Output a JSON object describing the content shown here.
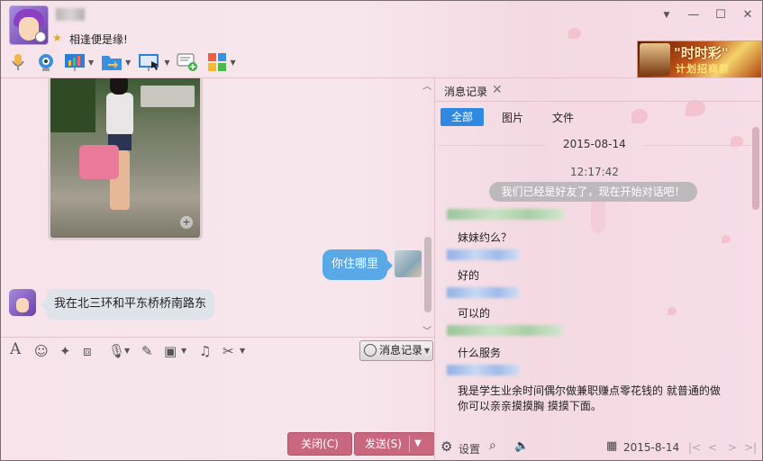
{
  "header": {
    "contact_name": "",
    "signature": "相逢便是缘!",
    "window_buttons": {
      "menu": "▼",
      "minimize": "—",
      "maximize": "☐",
      "close": "✕"
    },
    "toolbar_icons": [
      "microphone-icon",
      "video-camera-icon",
      "presentation-icon",
      "file-transfer-icon",
      "remote-desktop-icon",
      "group-chat-icon",
      "apps-icon"
    ]
  },
  "ad": {
    "line1": "\"时时彩\"",
    "line2": "计划招商群"
  },
  "chat": {
    "messages": [
      {
        "from": "me",
        "text": "你住哪里"
      },
      {
        "from": "contact",
        "text": "我在北三环和平东桥桥南路东"
      }
    ]
  },
  "input_toolbar": {
    "icons": [
      "font-icon",
      "emoji-icon",
      "magic-icon",
      "screenshot-icon",
      "voice-icon",
      "edit-icon",
      "image-icon",
      "music-icon",
      "scissors-icon"
    ],
    "history_label": "消息记录"
  },
  "buttons": {
    "close": "关闭(C)",
    "send": "发送(S)"
  },
  "history": {
    "tab_title": "消息记录",
    "filters": [
      "全部",
      "图片",
      "文件"
    ],
    "date": "2015-08-14",
    "time": "12:17:42",
    "system_notice": "我们已经是好友了，现在开始对话吧！",
    "messages": [
      {
        "text": "妹妹约么？"
      },
      {
        "text": "好的"
      },
      {
        "text": "可以的"
      },
      {
        "text": "什么服务"
      },
      {
        "text": "我是学生业余时间偶尔做兼职赚点零花钱的 就普通的做你可以亲亲摸摸胸 摸摸下面。"
      }
    ],
    "bottom": {
      "settings": "设置",
      "date_value": "2015-8-14",
      "nav": [
        "|<",
        "<",
        ">",
        ">|"
      ]
    }
  }
}
